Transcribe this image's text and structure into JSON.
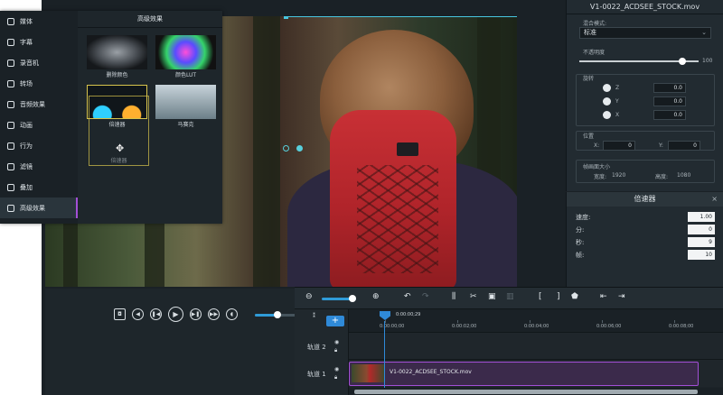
{
  "library": {
    "title": "高级效果",
    "nav": [
      {
        "label": "媒体",
        "icon": "folder-icon"
      },
      {
        "label": "字幕",
        "icon": "text-icon"
      },
      {
        "label": "录音机",
        "icon": "microphone-icon"
      },
      {
        "label": "转场",
        "icon": "transition-icon"
      },
      {
        "label": "音频效果",
        "icon": "audio-effects-icon"
      },
      {
        "label": "动画",
        "icon": "animation-arrow-icon"
      },
      {
        "label": "行为",
        "icon": "behavior-icon"
      },
      {
        "label": "滤镜",
        "icon": "filter-icon"
      },
      {
        "label": "叠加",
        "icon": "overlay-icon"
      },
      {
        "label": "高级效果",
        "icon": "advanced-effects-icon"
      }
    ],
    "active_nav": "高级效果",
    "effects": [
      {
        "label": "删除颜色"
      },
      {
        "label": "颜色LUT"
      },
      {
        "label": "倍速器"
      },
      {
        "label": "马赛克"
      }
    ],
    "drag_label": "倍速器"
  },
  "properties": {
    "title": "V1-0022_ACDSEE_STOCK.mov",
    "blend_label": "混合模式:",
    "blend_value": "标准",
    "opacity_label": "不透明度",
    "opacity_value": "100",
    "opacity_fraction": 0.86,
    "rotate_label": "旋转",
    "rotate": [
      {
        "axis": "Z",
        "value": "0.0"
      },
      {
        "axis": "Y",
        "value": "0.0"
      },
      {
        "axis": "X",
        "value": "0.0"
      }
    ],
    "position_label": "位置",
    "pos_x_label": "X:",
    "pos_x": "0",
    "pos_y_label": "Y:",
    "pos_y": "0",
    "frame_label": "帧画面大小",
    "width_label": "宽度:",
    "width": "1920",
    "height_label": "高度:",
    "height": "1080"
  },
  "speed": {
    "title": "倍速器",
    "close": "×",
    "rows": [
      {
        "label": "速度:",
        "value": "1.00"
      },
      {
        "label": "分:",
        "value": "0"
      },
      {
        "label": "秒:",
        "value": "9"
      },
      {
        "label": "帧:",
        "value": "10"
      }
    ]
  },
  "transport": {
    "volume_fraction": 0.55
  },
  "timeline": {
    "playhead_time": "0:00:00;29",
    "add_track": "+",
    "tracks": [
      {
        "label": "轨道 2"
      },
      {
        "label": "轨道 1"
      }
    ],
    "ruler_ticks": [
      "0:00:00;00",
      "0:00:02;00",
      "0:00:04;00",
      "0:00:06;00",
      "0:00:08;00"
    ],
    "clip_name": "V1-0022_ACDSEE_STOCK.mov",
    "zoom_fraction": 0.9
  }
}
